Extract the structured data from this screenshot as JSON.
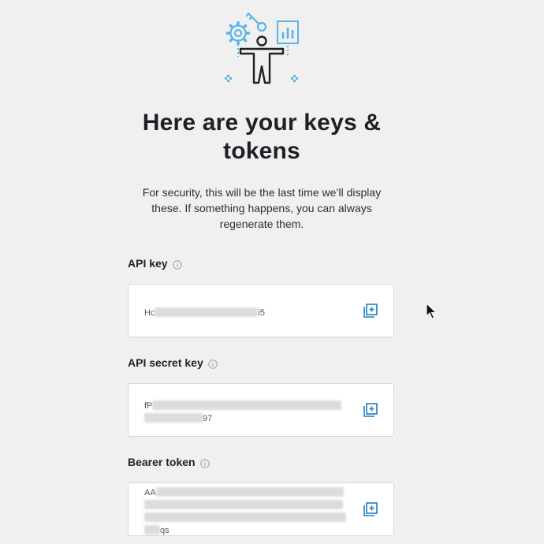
{
  "header": {
    "title": "Here are your keys & tokens",
    "subtitle": "For security, this will be the last time we’ll display these. If something happens, you can always regenerate them."
  },
  "illustration": {
    "name": "developer-illustration",
    "accent_color": "#5ab4e5",
    "figure_color": "#1d2126"
  },
  "fields": [
    {
      "label": "API key",
      "value_start": "Hc",
      "value_end": "i5"
    },
    {
      "label": "API secret key",
      "value_start": "fP",
      "value_end": "97"
    },
    {
      "label": "Bearer token",
      "value_start": "AA",
      "value_end": "qs"
    }
  ],
  "colors": {
    "background": "#f0f0f0",
    "card": "#ffffff",
    "accent": "#1d9bf0"
  }
}
